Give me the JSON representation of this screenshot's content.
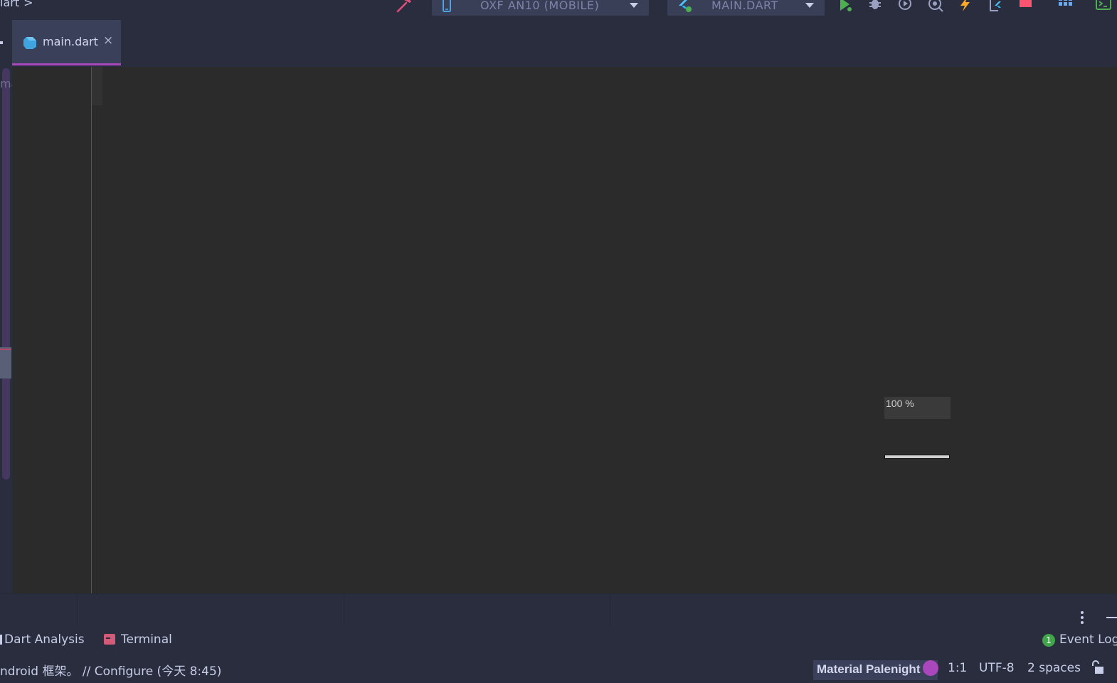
{
  "breadcrumb": {
    "text": "lart"
  },
  "toolbar": {
    "device_selector": "OXF AN10 (MOBILE)",
    "run_config": "MAIN.DART",
    "icons": [
      "hammer-icon",
      "phone-icon",
      "flutter-config-icon",
      "run-icon",
      "debug-icon",
      "profile-icon",
      "attach-debugger-icon",
      "hot-reload-icon",
      "flutter-inspector-icon",
      "stop-icon",
      "layout-icon",
      "terminal-icon"
    ]
  },
  "tabs": [
    {
      "label": "main.dart",
      "close": "×",
      "icon": "dart-icon",
      "active": true
    }
  ],
  "editor": {
    "left_strip_text": "ma",
    "zoom_label": "100 %",
    "zoom_level_percent": 100
  },
  "tool_windows": {
    "dart_analysis": "Dart Analysis",
    "terminal": "Terminal",
    "event_log": "Event Log",
    "event_log_count": "1"
  },
  "status_bar": {
    "message": "ndroid 框架。 // Configure (今天 8:45)",
    "theme": "Material Palenight",
    "theme_color": "#ab47bc",
    "position": "1:1",
    "encoding": "UTF-8",
    "indent": "2 spaces"
  },
  "colors": {
    "background": "#292d3e",
    "editor_bg": "#2b2b2b",
    "accent": "#ab47bc",
    "run_green": "#4caf50",
    "stop_red": "#ff5370"
  }
}
